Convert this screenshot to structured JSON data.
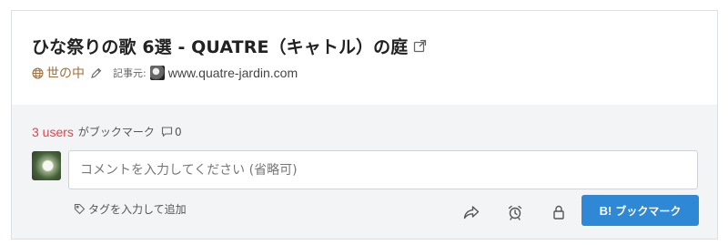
{
  "entry": {
    "title": "ひな祭りの歌 6選 - QUATRE（キャトル）の庭",
    "category": "世の中",
    "source_label": "記事元:",
    "domain": "www.quatre-jardin.com"
  },
  "stats": {
    "users_count": "3 users",
    "users_suffix": "がブックマーク",
    "comment_count": "0"
  },
  "form": {
    "comment_placeholder": "コメントを入力してください (省略可)",
    "tag_label": "タグを入力して追加",
    "bookmark_b": "B!",
    "bookmark_label": "ブックマーク"
  },
  "colors": {
    "accent_blue": "#2f88d5",
    "users_red": "#e4424b",
    "category_brown": "#a0713b"
  },
  "icons": [
    "external-link-icon",
    "globe-icon",
    "pencil-icon",
    "comment-icon",
    "tag-icon",
    "share-icon",
    "alarm-icon",
    "lock-icon"
  ]
}
